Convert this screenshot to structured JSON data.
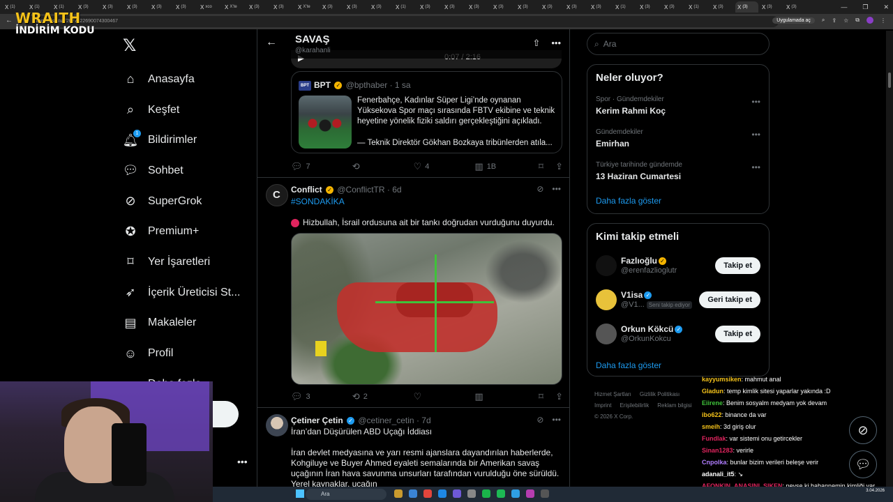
{
  "browser": {
    "tabs": [
      "(1)",
      "(1)",
      "(1)",
      "(3)",
      "(3)",
      "(3)",
      "(3)",
      "(3)",
      "xco",
      "X’te",
      "(3)",
      "(3)",
      "X’te",
      "(3)",
      "(3)",
      "(3)",
      "(1)",
      "(3)",
      "(3)",
      "(3)",
      "(3)",
      "(3)",
      "(3)",
      "(3)",
      "(3)",
      "(1)",
      "(3)",
      "(3)",
      "(1)",
      "(3)",
      "(3)",
      "(3)",
      "(3)"
    ],
    "url": "x.com/.../status/2027822690074300467",
    "app_chip": "Uygulamada aç"
  },
  "overlay_logo": {
    "line1": "WRAITH",
    "line2": "İNDİRİM KODU"
  },
  "nav": {
    "items": [
      {
        "label": "Anasayfa",
        "icon": "home-icon"
      },
      {
        "label": "Keşfet",
        "icon": "search-icon"
      },
      {
        "label": "Bildirimler",
        "icon": "bell-icon",
        "badge": "1"
      },
      {
        "label": "Sohbet",
        "icon": "chat-icon"
      },
      {
        "label": "SuperGrok",
        "icon": "grok-icon"
      },
      {
        "label": "Premium+",
        "icon": "verified-icon"
      },
      {
        "label": "Yer İşaretleri",
        "icon": "bookmark-icon"
      },
      {
        "label": "İçerik Üreticisi St...",
        "icon": "rocket-icon"
      },
      {
        "label": "Makaleler",
        "icon": "article-icon"
      },
      {
        "label": "Profil",
        "icon": "profile-icon"
      },
      {
        "label": "Daha fazla",
        "icon": "more-icon"
      }
    ]
  },
  "header": {
    "title": "SAVAŞ",
    "handle": "@karahanli"
  },
  "video": {
    "time": "0:07 / 2:16"
  },
  "quote": {
    "name": "BPT",
    "handle": "@bpthaber",
    "time": "· 1 sa",
    "text": "Fenerbahçe, Kadınlar Süper Ligi’nde oynanan Yüksekova Spor maçı sırasında FBTV ekibine ve teknik heyetine yönelik fiziki saldırı gerçekleştiğini açıkladı.",
    "text2": "— Teknik Direktör Gökhan Bozkaya tribünlerden atıla...",
    "avatar_text": "BPT"
  },
  "actions1": {
    "replies": "7",
    "reposts": "",
    "likes": "4",
    "views": "1B"
  },
  "tweet2": {
    "name": "Conflict",
    "handle": "@ConflictTR",
    "time": "· 6d",
    "hashtag": "#SONDAKİKA",
    "text": "Hizbullah, İsrail ordusuna ait bir tankı doğrudan vurduğunu duyurdu."
  },
  "actions2": {
    "replies": "3",
    "reposts": "2",
    "likes": "",
    "views": ""
  },
  "tweet3": {
    "name": "Çetiner Çetin",
    "handle": "@cetiner_cetin",
    "time": "· 7d",
    "title": "İran’dan Düşürülen ABD Uçağı İddiası",
    "text": "İran devlet medyasına ve yarı resmi ajanslara dayandırılan haberlerde, Kohgiluye ve Buyer Ahmed eyaleti semalarında bir Amerikan savaş uçağının İran hava savunma unsurları tarafından vurulduğu öne sürüldü. Yerel kaynaklar, uçağın"
  },
  "search": {
    "placeholder": "Ara"
  },
  "trends": {
    "title": "Neler oluyor?",
    "items": [
      {
        "category": "Spor · Gündemdekiler",
        "name": "Kerim Rahmi Koç"
      },
      {
        "category": "Gündemdekiler",
        "name": "Emirhan"
      },
      {
        "category": "Türkiye tarihinde gündemde",
        "name": "13 Haziran Cumartesi"
      }
    ],
    "show_more": "Daha fazla göster"
  },
  "follow": {
    "title": "Kimi takip etmeli",
    "items": [
      {
        "name": "Fazlıoğlu",
        "handle": "@erenfazlioglutr",
        "button": "Takip et",
        "chip": ""
      },
      {
        "name": "V1isa",
        "handle": "@V1...",
        "button": "Geri takip et",
        "chip": "Seni takip ediyor"
      },
      {
        "name": "Orkun Kökcü",
        "handle": "@OrkunKokcu",
        "button": "Takip et",
        "chip": ""
      }
    ],
    "show_more": "Daha fazla göster"
  },
  "footer": {
    "links": [
      "Hizmet Şartları",
      "Gizlilik Politikası",
      "Imprint",
      "Erişilebilirlik",
      "Reklam bilgisi"
    ],
    "copyright": "© 2026 X Corp."
  },
  "chat": [
    {
      "user": "kayyumsiken",
      "msg": ": mahmut anal",
      "color": "#f4c21a"
    },
    {
      "user": "Gladun",
      "msg": ": temp kimlik sitesi yaparlar yakında :D",
      "color": "#f4c21a"
    },
    {
      "user": "Eiirene",
      "msg": ": Benim sosyalm medyam yok devam",
      "color": "#3fc23a"
    },
    {
      "user": "ibo622",
      "msg": ": binance da var",
      "color": "#f4c21a"
    },
    {
      "user": "smeih",
      "msg": ": 3d giriş olur",
      "color": "#f4c21a"
    },
    {
      "user": "Fundlak",
      "msg": ": var sistemi onu getircekler",
      "color": "#e0245e"
    },
    {
      "user": "Sinan1283",
      "msg": ": verirle",
      "color": "#e0245e"
    },
    {
      "user": "Cnpolka",
      "msg": ": bunlar bizim verileri beleşe verir",
      "color": "#b07dff"
    },
    {
      "user": "adanali_it5",
      "msg": ": ↘",
      "color": "#ffffff"
    },
    {
      "user": "AFONKIN_ANASINI_SIKEN",
      "msg": ": neyse ki babannemin kimliği var",
      "color": "#e0245e"
    }
  ],
  "taskbar": {
    "search": "Ara",
    "time": "",
    "date": "3.04.2026"
  }
}
